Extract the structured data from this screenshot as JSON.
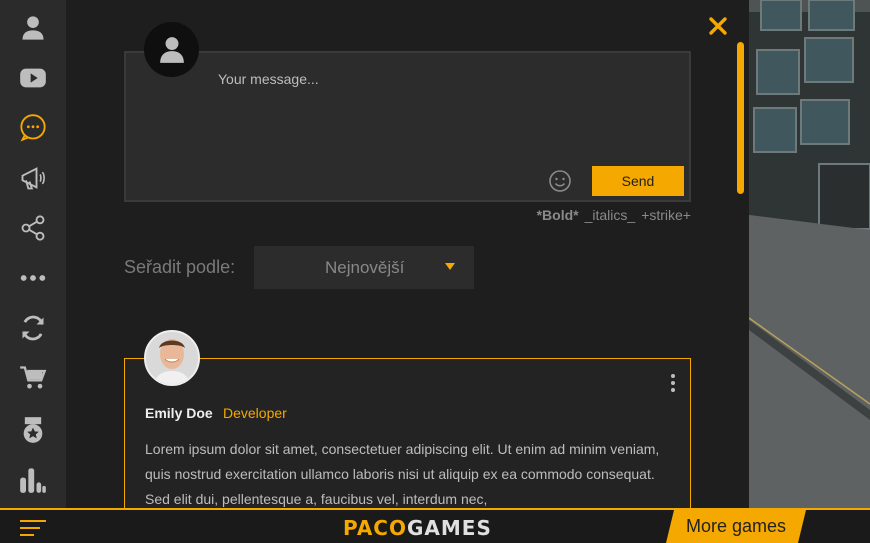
{
  "sidebar": {
    "items": [
      {
        "icon": "user-icon"
      },
      {
        "icon": "youtube-icon"
      },
      {
        "icon": "chat-icon",
        "active": true
      },
      {
        "icon": "megaphone-icon"
      },
      {
        "icon": "share-icon"
      },
      {
        "icon": "more-icon"
      },
      {
        "icon": "refresh-icon"
      },
      {
        "icon": "cart-icon"
      },
      {
        "icon": "medal-icon"
      },
      {
        "icon": "stats-icon"
      }
    ]
  },
  "composer": {
    "placeholder": "Your message...",
    "send_label": "Send",
    "format_bold": "*Bold*",
    "format_italics": "_italics_",
    "format_strike": "+strike+"
  },
  "sort": {
    "label": "Seřadit podle:",
    "selected": "Nejnovější"
  },
  "comment": {
    "author": "Emily Doe",
    "role": "Developer",
    "text": "Lorem ipsum dolor sit amet, consectetuer adipiscing elit. Ut enim ad minim veniam, quis nostrud exercitation ullamco laboris nisi ut aliquip ex ea commodo consequat. Sed elit dui, pellentesque a, faucibus vel, interdum nec,"
  },
  "bottombar": {
    "logo_paco": "PACO",
    "logo_games": "GAMES",
    "more_games": "More games"
  },
  "colors": {
    "accent": "#f5a800",
    "sidebar_bg": "#2b2b2b",
    "panel_bg": "#1e1e1e"
  }
}
